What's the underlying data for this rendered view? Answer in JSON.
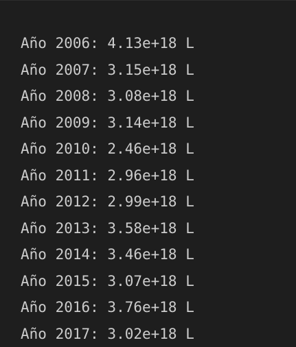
{
  "terminal": {
    "lines": [
      "Año 2006: 4.13e+18 L",
      "Año 2007: 3.15e+18 L",
      "Año 2008: 3.08e+18 L",
      "Año 2009: 3.14e+18 L",
      "Año 2010: 2.46e+18 L",
      "Año 2011: 2.96e+18 L",
      "Año 2012: 2.99e+18 L",
      "Año 2013: 3.58e+18 L",
      "Año 2014: 3.46e+18 L",
      "Año 2015: 3.07e+18 L",
      "Año 2016: 3.76e+18 L",
      "Año 2017: 3.02e+18 L"
    ]
  },
  "colors": {
    "background": "#1e1e1e",
    "text": "#cccccc"
  }
}
